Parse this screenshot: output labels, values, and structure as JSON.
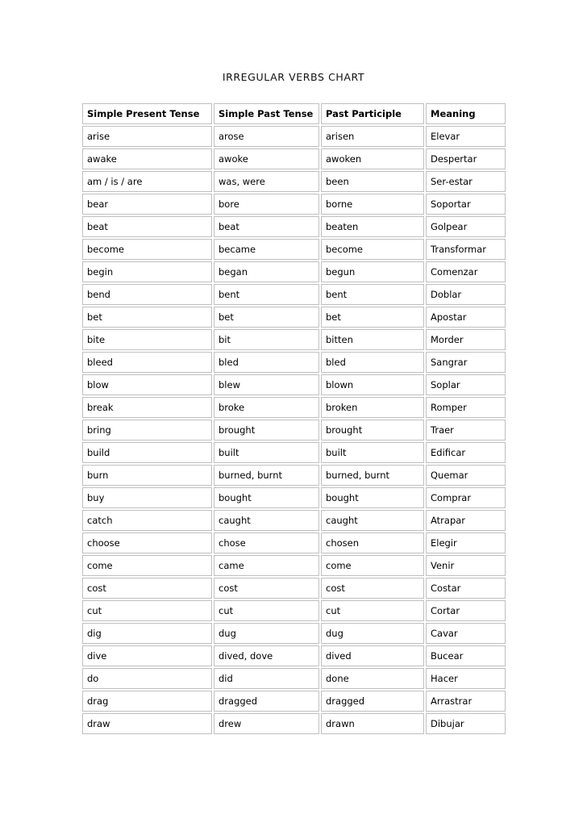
{
  "document": {
    "title": "IRREGULAR VERBS CHART"
  },
  "table": {
    "columns": [
      "Simple Present Tense",
      "Simple Past Tense",
      "Past Participle",
      "Meaning"
    ],
    "rows": [
      [
        "arise",
        "arose",
        "arisen",
        "Elevar"
      ],
      [
        "awake",
        "awoke",
        "awoken",
        "Despertar"
      ],
      [
        "am / is / are",
        "was, were",
        "been",
        "Ser-estar"
      ],
      [
        "bear",
        "bore",
        "borne",
        "Soportar"
      ],
      [
        "beat",
        "beat",
        "beaten",
        "Golpear"
      ],
      [
        "become",
        "became",
        "become",
        "Transformar"
      ],
      [
        "begin",
        "began",
        "begun",
        "Comenzar"
      ],
      [
        "bend",
        "bent",
        "bent",
        "Doblar"
      ],
      [
        "bet",
        "bet",
        "bet",
        "Apostar"
      ],
      [
        "bite",
        "bit",
        "bitten",
        "Morder"
      ],
      [
        "bleed",
        "bled",
        "bled",
        "Sangrar"
      ],
      [
        "blow",
        "blew",
        "blown",
        "Soplar"
      ],
      [
        "break",
        "broke",
        "broken",
        "Romper"
      ],
      [
        "bring",
        "brought",
        "brought",
        "Traer"
      ],
      [
        "build",
        "built",
        "built",
        "Edificar"
      ],
      [
        "burn",
        "burned, burnt",
        "burned, burnt",
        "Quemar"
      ],
      [
        "buy",
        "bought",
        "bought",
        "Comprar"
      ],
      [
        "catch",
        "caught",
        "caught",
        "Atrapar"
      ],
      [
        "choose",
        "chose",
        "chosen",
        "Elegir"
      ],
      [
        "come",
        "came",
        "come",
        "Venir"
      ],
      [
        "cost",
        "cost",
        "cost",
        "Costar"
      ],
      [
        "cut",
        "cut",
        "cut",
        "Cortar"
      ],
      [
        "dig",
        "dug",
        "dug",
        "Cavar"
      ],
      [
        "dive",
        "dived, dove",
        "dived",
        "Bucear"
      ],
      [
        "do",
        "did",
        "done",
        "Hacer"
      ],
      [
        "drag",
        "dragged",
        "dragged",
        "Arrastrar"
      ],
      [
        "draw",
        "drew",
        "drawn",
        "Dibujar"
      ]
    ]
  },
  "colors": {
    "page_background": "#ffffff",
    "cell_border": "#bfbfbf",
    "text": "#000000"
  }
}
